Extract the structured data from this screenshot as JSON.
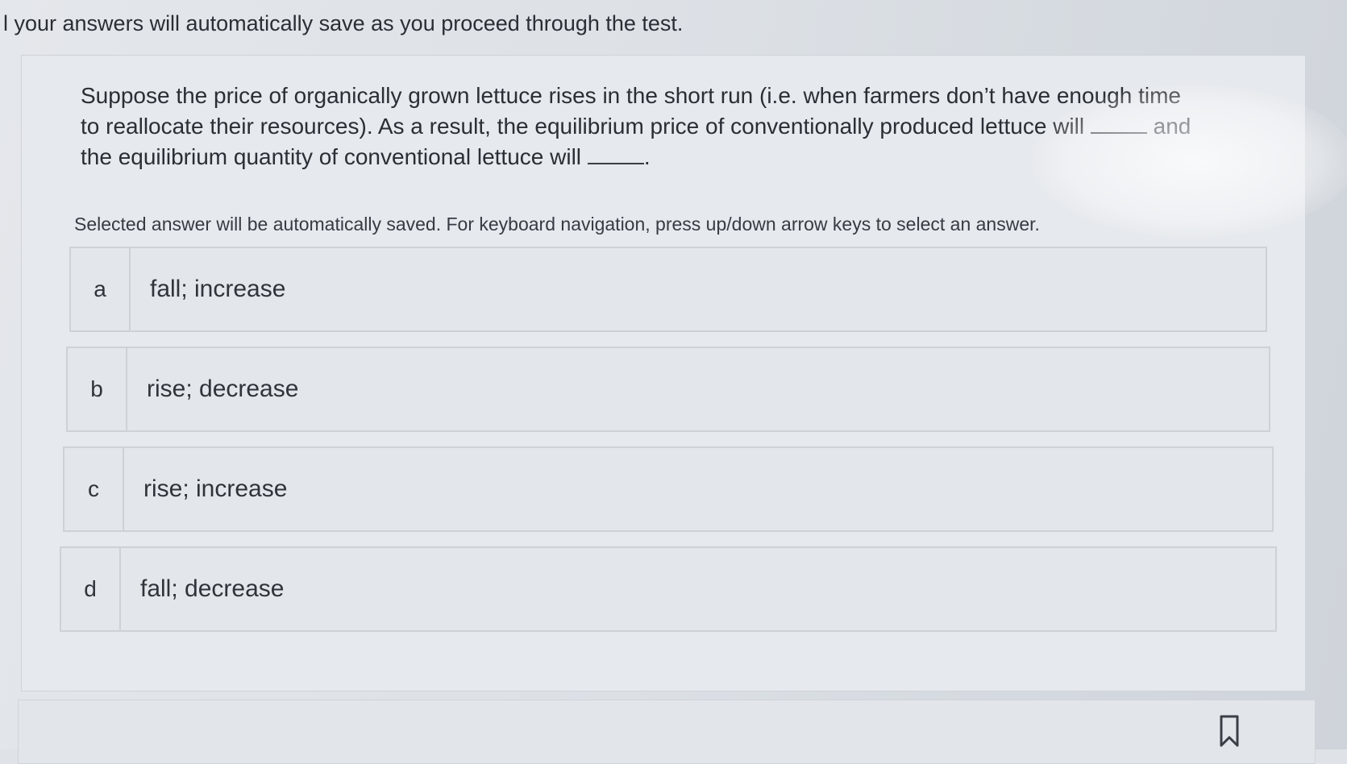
{
  "notice": {
    "text": "l your answers will automatically save as you proceed through the test."
  },
  "question": {
    "part1": "Suppose the price of organically grown lettuce rises in the short run (i.e. when farmers don’t have enough time to reallocate their resources). As a result, the equilibrium price of conventionally produced lettuce will",
    "part2": "and the equilibrium quantity of conventional lettuce will",
    "part3": "."
  },
  "instructions": "Selected answer will be automatically saved. For keyboard navigation, press up/down arrow keys to select an answer.",
  "answers": [
    {
      "letter": "a",
      "text": "fall; increase"
    },
    {
      "letter": "b",
      "text": "rise; decrease"
    },
    {
      "letter": "c",
      "text": "rise; increase"
    },
    {
      "letter": "d",
      "text": "fall; decrease"
    }
  ],
  "icons": {
    "bookmark": "bookmark-icon"
  }
}
